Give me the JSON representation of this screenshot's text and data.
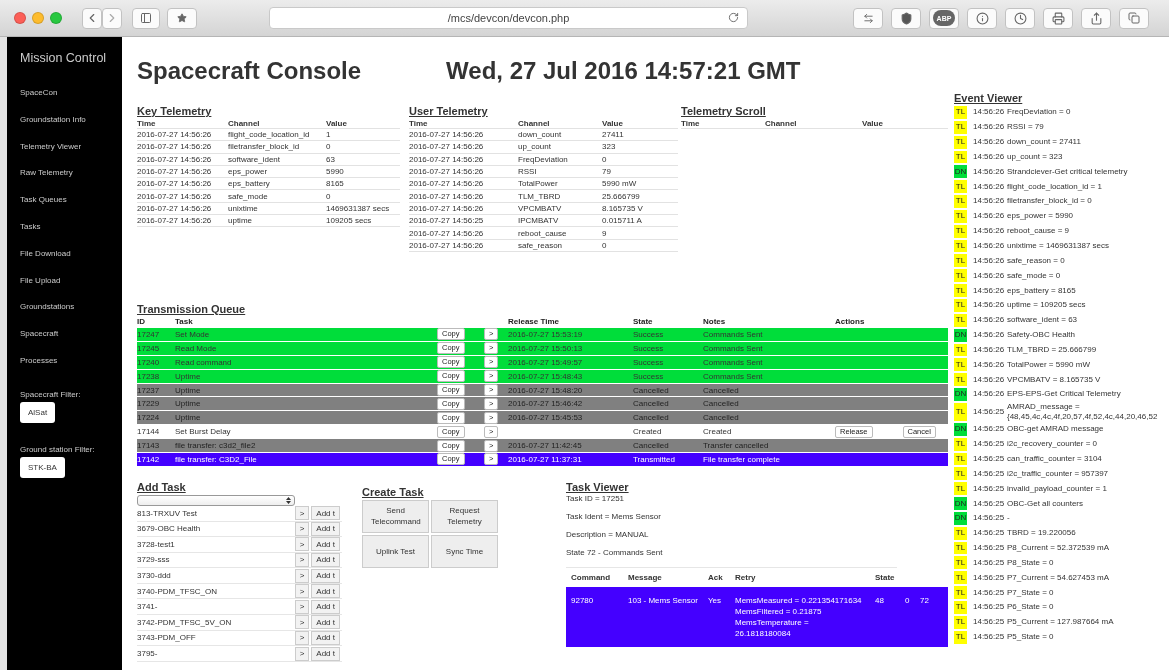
{
  "browser": {
    "url": "/mcs/devcon/devcon.php",
    "adblock_label": "ABP"
  },
  "sidebar": {
    "title": "Mission Control",
    "items": [
      {
        "label": "SpaceCon"
      },
      {
        "label": "Groundstation Info"
      },
      {
        "label": "Telemetry Viewer"
      },
      {
        "label": "Raw Telemetry"
      },
      {
        "label": "Task Queues"
      },
      {
        "label": "Tasks"
      },
      {
        "label": "File Download"
      },
      {
        "label": "File Upload"
      },
      {
        "label": "Groundstations"
      },
      {
        "label": "Spacecraft"
      },
      {
        "label": "Processes"
      }
    ],
    "filters": [
      {
        "label": "Spacecraft Filter:",
        "value": "AlSat"
      },
      {
        "label": "Ground station Filter:",
        "value": "STK-BA"
      }
    ]
  },
  "header": {
    "title": "Spacecraft Console",
    "datetime": "Wed, 27 Jul 2016 14:57:21 GMT"
  },
  "key_telemetry": {
    "title": "Key Telemetry",
    "columns": [
      "Time",
      "Channel",
      "Value"
    ],
    "rows": [
      [
        "2016-07-27 14:56:26",
        "flight_code_location_id",
        "1"
      ],
      [
        "2016-07-27 14:56:26",
        "filetransfer_block_id",
        "0"
      ],
      [
        "2016-07-27 14:56:26",
        "software_ident",
        "63"
      ],
      [
        "2016-07-27 14:56:26",
        "eps_power",
        "5990"
      ],
      [
        "2016-07-27 14:56:26",
        "eps_battery",
        "8165"
      ],
      [
        "2016-07-27 14:56:26",
        "safe_mode",
        "0"
      ],
      [
        "2016-07-27 14:56:26",
        "unixtime",
        "1469631387 secs"
      ],
      [
        "2016-07-27 14:56:26",
        "uptime",
        "109205 secs"
      ]
    ]
  },
  "user_telemetry": {
    "title": "User Telemetry",
    "columns": [
      "Time",
      "Channel",
      "Value"
    ],
    "rows": [
      [
        "2016-07-27 14:56:26",
        "down_count",
        "27411"
      ],
      [
        "2016-07-27 14:56:26",
        "up_count",
        "323"
      ],
      [
        "2016-07-27 14:56:26",
        "FreqDeviation",
        "0"
      ],
      [
        "2016-07-27 14:56:26",
        "RSSI",
        "79"
      ],
      [
        "2016-07-27 14:56:26",
        "TotalPower",
        "5990 mW"
      ],
      [
        "2016-07-27 14:56:26",
        "TLM_TBRD",
        "25.666799"
      ],
      [
        "2016-07-27 14:56:26",
        "VPCMBATV",
        "8.165735 V"
      ],
      [
        "2016-07-27 14:56:25",
        "IPCMBATV",
        "0.015711 A"
      ],
      [
        "2016-07-27 14:56:26",
        "reboot_cause",
        "9"
      ],
      [
        "2016-07-27 14:56:26",
        "safe_reason",
        "0"
      ]
    ]
  },
  "telemetry_scroll": {
    "title": "Telemetry Scroll",
    "columns": [
      "Time",
      "Channel",
      "Value"
    ]
  },
  "transmission_queue": {
    "title": "Transmission Queue",
    "columns": [
      "ID",
      "Task",
      "Release Time",
      "State",
      "Notes",
      "Actions"
    ],
    "rows": [
      {
        "kind": "success",
        "id": "17247",
        "task": "Set Mode",
        "copy": "Copy",
        "go": ">",
        "release_time": "2016-07-27 15:53:19",
        "state": "Success",
        "notes": "Commands Sent"
      },
      {
        "kind": "success",
        "id": "17245",
        "task": "Read Mode",
        "copy": "Copy",
        "go": ">",
        "release_time": "2016-07-27 15:50:13",
        "state": "Success",
        "notes": "Commands Sent"
      },
      {
        "kind": "success",
        "id": "17240",
        "task": "Read command",
        "copy": "Copy",
        "go": ">",
        "release_time": "2016-07-27 15:49:57",
        "state": "Success",
        "notes": "Commands Sent"
      },
      {
        "kind": "success",
        "id": "17238",
        "task": "Uptime",
        "copy": "Copy",
        "go": ">",
        "release_time": "2016-07-27 15:48:43",
        "state": "Success",
        "notes": "Commands Sent"
      },
      {
        "kind": "cancelled",
        "id": "17237",
        "task": "Uptime",
        "copy": "Copy",
        "go": ">",
        "release_time": "2016-07-27 15:48:20",
        "state": "Cancelled",
        "notes": "Cancelled"
      },
      {
        "kind": "cancelled",
        "id": "17229",
        "task": "Uptime",
        "copy": "Copy",
        "go": ">",
        "release_time": "2016-07-27 15:46:42",
        "state": "Cancelled",
        "notes": "Cancelled"
      },
      {
        "kind": "cancelled",
        "id": "17224",
        "task": "Uptime",
        "copy": "Copy",
        "go": ">",
        "release_time": "2016-07-27 15:45:53",
        "state": "Cancelled",
        "notes": "Cancelled"
      },
      {
        "kind": "created",
        "id": "17144",
        "task": "Set Burst Delay",
        "copy": "Copy",
        "go": ">",
        "state": "Created",
        "notes": "Created",
        "actions": [
          "Release",
          "Cancel"
        ]
      },
      {
        "kind": "cancelled",
        "id": "17143",
        "task": "file transfer: c3d2_file2",
        "copy": "Copy",
        "go": ">",
        "release_time": "2016-07-27 11:42:45",
        "state": "Cancelled",
        "notes": "Transfer cancelled"
      },
      {
        "kind": "transmitted",
        "id": "17142",
        "task": "file transfer: C3D2_File",
        "copy": "Copy",
        "go": ">",
        "release_time": "2016-07-27 11:37:31",
        "state": "Transmitted",
        "notes": "File transfer complete"
      }
    ]
  },
  "add_task": {
    "title": "Add Task",
    "rows": [
      {
        "name": "813-TRXUV Test",
        "go": ">",
        "add": "Add t"
      },
      {
        "name": "3679-OBC Health",
        "go": ">",
        "add": "Add t"
      },
      {
        "name": "3728-test1",
        "go": ">",
        "add": "Add t"
      },
      {
        "name": "3729-sss",
        "go": ">",
        "add": "Add t"
      },
      {
        "name": "3730-ddd",
        "go": ">",
        "add": "Add t"
      },
      {
        "name": "3740-PDM_TFSC_ON",
        "go": ">",
        "add": "Add t"
      },
      {
        "name": "3741-",
        "go": ">",
        "add": "Add t"
      },
      {
        "name": "3742-PDM_TFSC_5V_ON",
        "go": ">",
        "add": "Add t"
      },
      {
        "name": "3743-PDM_OFF",
        "go": ">",
        "add": "Add t"
      },
      {
        "name": "3795-",
        "go": ">",
        "add": "Add t"
      }
    ]
  },
  "create_task": {
    "title": "Create Task",
    "buttons": [
      "Send Telecommand",
      "Request Telemetry",
      "Uplink Test",
      "Sync Time"
    ]
  },
  "task_viewer": {
    "title": "Task Viewer",
    "lines": [
      "Task ID = 17251",
      "Task Ident = Mems Sensor",
      "Description = MANUAL",
      "State 72 - Commands Sent"
    ],
    "columns": [
      "Command",
      "Message",
      "Ack",
      "Retry",
      "State"
    ],
    "rows": [
      {
        "selected": true,
        "command": "92780",
        "message": "103 - Mems Sensor",
        "ack": "Yes",
        "retry": [
          "MemsMeasured = 0.221354171634",
          "MemsFiltered = 0.21875",
          "MemsTemperature =",
          "26.1818180084"
        ],
        "state": "48",
        "column_6": "0",
        "column_7": "72"
      }
    ]
  },
  "event_viewer": {
    "title": "Event Viewer",
    "events": [
      {
        "kind": "tl",
        "badge": "TL",
        "time": "14:56:26",
        "text": "FreqDeviation = 0"
      },
      {
        "kind": "tl",
        "badge": "TL",
        "time": "14:56:26",
        "text": "RSSI = 79"
      },
      {
        "kind": "tl",
        "badge": "TL",
        "time": "14:56:26",
        "text": "down_count = 27411"
      },
      {
        "kind": "tl",
        "badge": "TL",
        "time": "14:56:26",
        "text": "up_count = 323"
      },
      {
        "kind": "dn",
        "badge": "DN",
        "time": "14:56:26",
        "text": "Strandciever-Get critical telemetry"
      },
      {
        "kind": "tl",
        "badge": "TL",
        "time": "14:56:26",
        "text": "flight_code_location_id = 1"
      },
      {
        "kind": "tl",
        "badge": "TL",
        "time": "14:56:26",
        "text": "filetransfer_block_id = 0"
      },
      {
        "kind": "tl",
        "badge": "TL",
        "time": "14:56:26",
        "text": "eps_power = 5990"
      },
      {
        "kind": "tl",
        "badge": "TL",
        "time": "14:56:26",
        "text": "reboot_cause = 9"
      },
      {
        "kind": "tl",
        "badge": "TL",
        "time": "14:56:26",
        "text": "unixtime = 1469631387 secs"
      },
      {
        "kind": "tl",
        "badge": "TL",
        "time": "14:56:26",
        "text": "safe_reason = 0"
      },
      {
        "kind": "tl",
        "badge": "TL",
        "time": "14:56:26",
        "text": "safe_mode = 0"
      },
      {
        "kind": "tl",
        "badge": "TL",
        "time": "14:56:26",
        "text": "eps_battery = 8165"
      },
      {
        "kind": "tl",
        "badge": "TL",
        "time": "14:56:26",
        "text": "uptime = 109205 secs"
      },
      {
        "kind": "tl",
        "badge": "TL",
        "time": "14:56:26",
        "text": "software_ident = 63"
      },
      {
        "kind": "dn",
        "badge": "DN",
        "time": "14:56:26",
        "text": "Safety-OBC Health"
      },
      {
        "kind": "tl",
        "badge": "TL",
        "time": "14:56:26",
        "text": "TLM_TBRD = 25.666799"
      },
      {
        "kind": "tl",
        "badge": "TL",
        "time": "14:56:26",
        "text": "TotalPower = 5990 mW"
      },
      {
        "kind": "tl",
        "badge": "TL",
        "time": "14:56:26",
        "text": "VPCMBATV = 8.165735 V"
      },
      {
        "kind": "dn",
        "badge": "DN",
        "time": "14:56:26",
        "text": "EPS-EPS-Get Critical Telemetry"
      },
      {
        "kind": "tl",
        "badge": "TL",
        "time": "14:56:25",
        "text": "AMRAD_message = {48,45,4c,4c,4f,20,57,4f,52,4c,44,20,46,52"
      },
      {
        "kind": "dn",
        "badge": "DN",
        "time": "14:56:25",
        "text": "OBC-get AMRAD message"
      },
      {
        "kind": "tl",
        "badge": "TL",
        "time": "14:56:25",
        "text": "i2c_recovery_counter = 0"
      },
      {
        "kind": "tl",
        "badge": "TL",
        "time": "14:56:25",
        "text": "can_traffic_counter = 3104"
      },
      {
        "kind": "tl",
        "badge": "TL",
        "time": "14:56:25",
        "text": "i2c_traffic_counter = 957397"
      },
      {
        "kind": "tl",
        "badge": "TL",
        "time": "14:56:25",
        "text": "invalid_payload_counter = 1"
      },
      {
        "kind": "dn",
        "badge": "DN",
        "time": "14:56:25",
        "text": "OBC-Get all counters"
      },
      {
        "kind": "dn",
        "badge": "DN",
        "time": "14:56:25",
        "text": "-"
      },
      {
        "kind": "tl",
        "badge": "TL",
        "time": "14:56:25",
        "text": "TBRD = 19.220056"
      },
      {
        "kind": "tl",
        "badge": "TL",
        "time": "14:56:25",
        "text": "P8_Current = 52.372539 mA"
      },
      {
        "kind": "tl",
        "badge": "TL",
        "time": "14:56:25",
        "text": "P8_State = 0"
      },
      {
        "kind": "tl",
        "badge": "TL",
        "time": "14:56:25",
        "text": "P7_Current = 54.627453 mA"
      },
      {
        "kind": "tl",
        "badge": "TL",
        "time": "14:56:25",
        "text": "P7_State = 0"
      },
      {
        "kind": "tl",
        "badge": "TL",
        "time": "14:56:25",
        "text": "P6_State = 0"
      },
      {
        "kind": "tl",
        "badge": "TL",
        "time": "14:56:25",
        "text": "P5_Current = 127.987664 mA"
      },
      {
        "kind": "tl",
        "badge": "TL",
        "time": "14:56:25",
        "text": "P5_State = 0"
      }
    ]
  }
}
